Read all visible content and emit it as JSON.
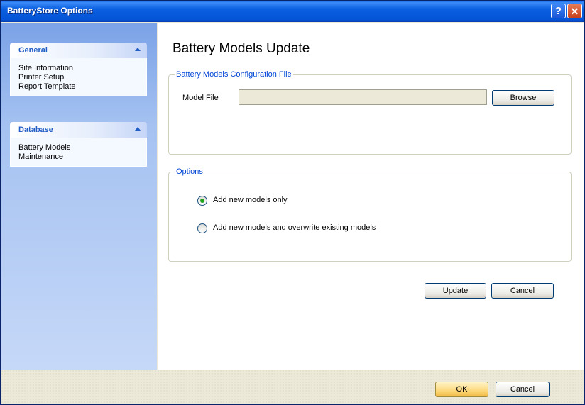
{
  "window": {
    "title": "BatteryStore Options",
    "help_glyph": "?",
    "close_glyph": "✕"
  },
  "sidebar": {
    "groups": [
      {
        "title": "General",
        "items": [
          "Site Information",
          "Printer Setup",
          "Report Template"
        ]
      },
      {
        "title": "Database",
        "items": [
          "Battery Models",
          "Maintenance"
        ]
      }
    ]
  },
  "main": {
    "title": "Battery Models Update",
    "config_group": {
      "legend": "Battery Models Configuration File",
      "model_file_label": "Model File",
      "model_file_value": "",
      "browse_label": "Browse"
    },
    "options_group": {
      "legend": "Options",
      "radios": [
        {
          "label": "Add new models only",
          "checked": true
        },
        {
          "label": "Add new models and overwrite existing models",
          "checked": false
        }
      ]
    },
    "update_label": "Update",
    "cancel_label": "Cancel"
  },
  "footer": {
    "ok_label": "OK",
    "cancel_label": "Cancel"
  },
  "colors": {
    "titlebar": "#0554d8",
    "legend_text": "#0046d5",
    "group_title": "#215dc6",
    "radio_dot": "#21a121"
  }
}
